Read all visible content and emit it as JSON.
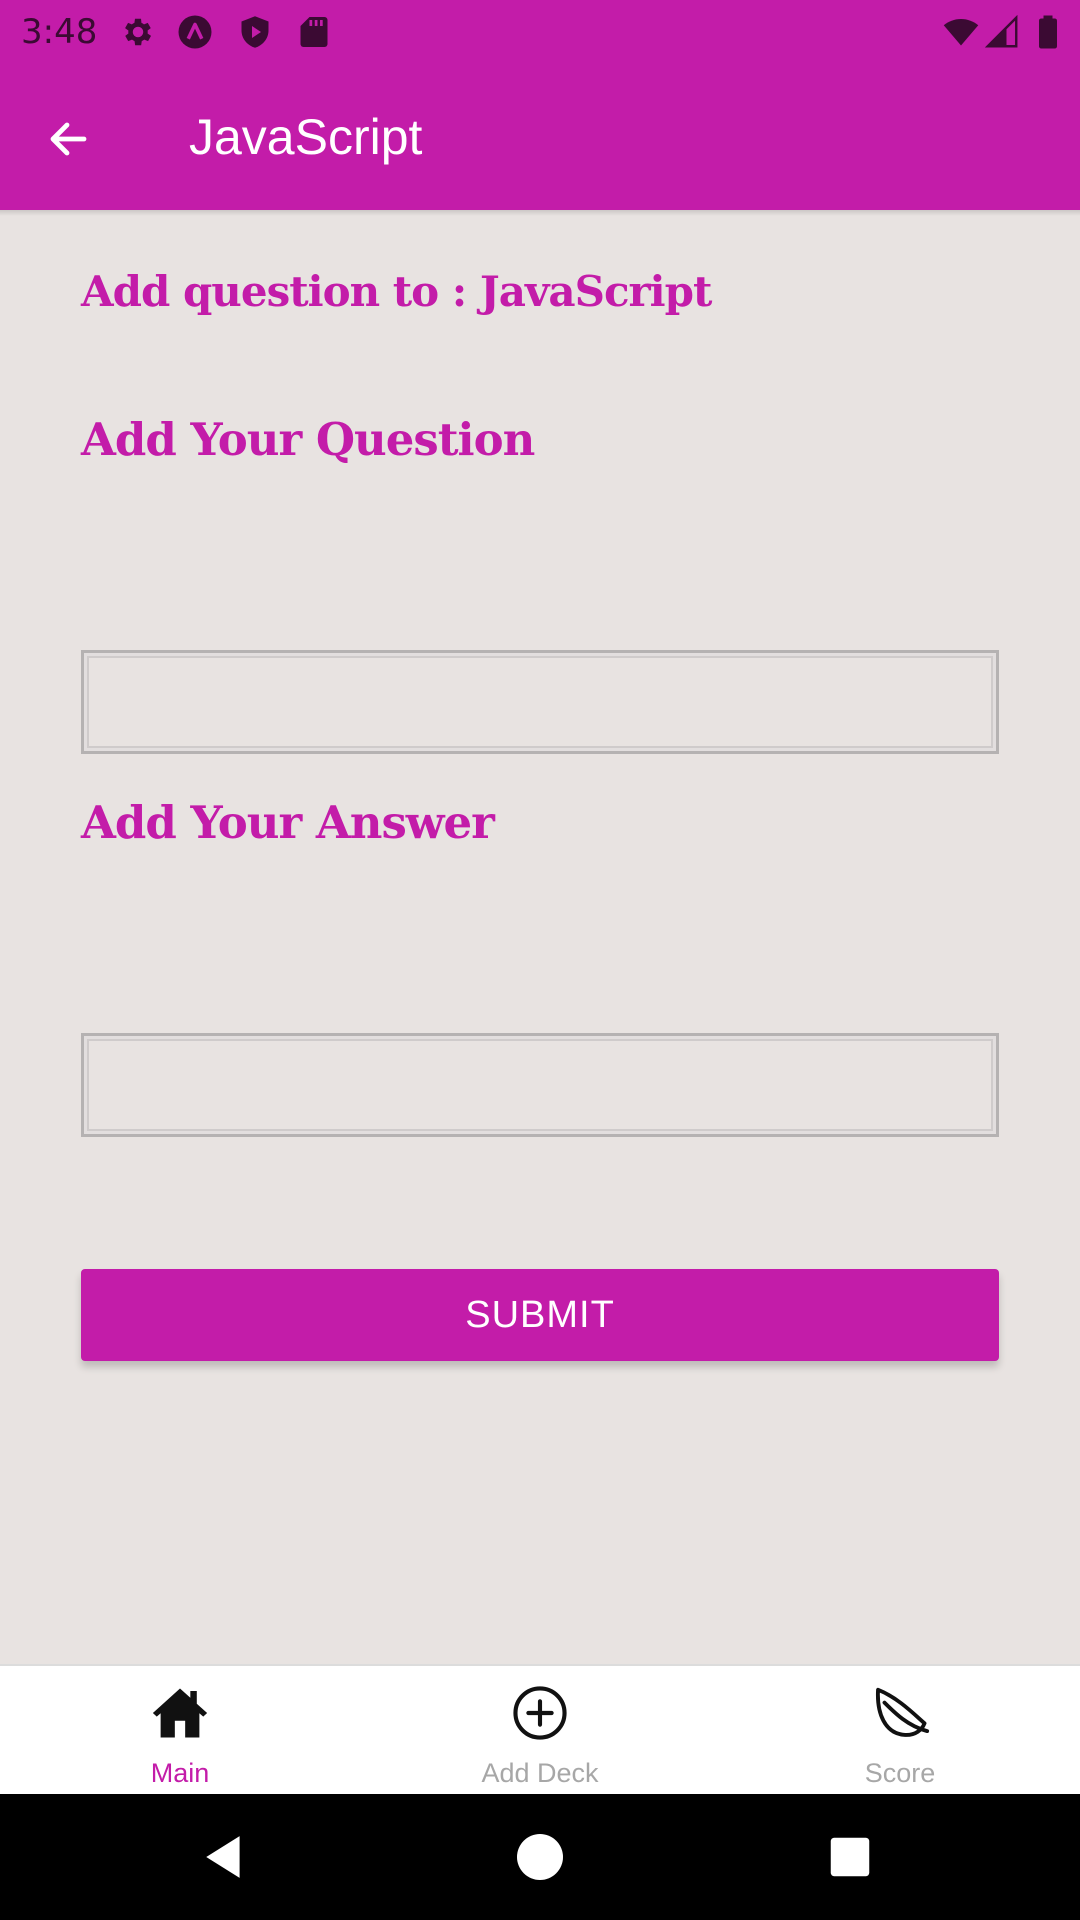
{
  "status_bar": {
    "time": "3:48",
    "left_icons": [
      "gear-icon",
      "app-badge-icon",
      "shield-play-icon",
      "sd-card-icon"
    ],
    "right_icons": [
      "wifi-icon",
      "cell-signal-icon",
      "battery-icon"
    ]
  },
  "app_bar": {
    "title": "JavaScript",
    "back_icon": "arrow-back-icon"
  },
  "form": {
    "heading": "Add question to : JavaScript",
    "question_label": "Add Your Question",
    "question_value": "",
    "answer_label": "Add Your Answer",
    "answer_value": "",
    "submit_label": "SUBMIT"
  },
  "tabs": [
    {
      "label": "Main",
      "icon": "home-icon",
      "active": true
    },
    {
      "label": "Add Deck",
      "icon": "add-circle-icon",
      "active": false
    },
    {
      "label": "Score",
      "icon": "leaf-icon",
      "active": false
    }
  ],
  "colors": {
    "primary": "#c31ca9",
    "background": "#e8e3e1",
    "tab_inactive": "#a7a7a7",
    "status_icons": "#3b0a33"
  },
  "nav_bar": {
    "icons": [
      "back-triangle-icon",
      "home-circle-icon",
      "recents-square-icon"
    ]
  }
}
